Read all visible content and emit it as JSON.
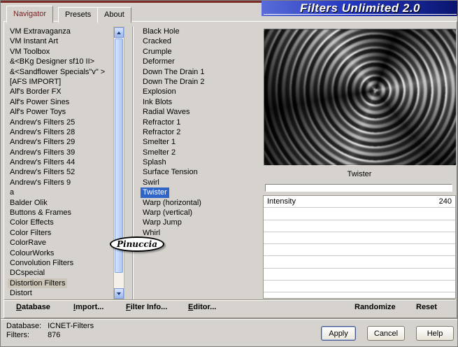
{
  "window": {
    "title": "Filters Unlimited 2.0"
  },
  "tabs": [
    {
      "label": "Navigator"
    },
    {
      "label": "Presets"
    },
    {
      "label": "About"
    }
  ],
  "category_list": {
    "items": [
      "VM Extravaganza",
      "VM Instant Art",
      "VM Toolbox",
      "&<BKg Designer sf10 II>",
      "&<Sandflower Specials\"v\" >",
      "[AFS IMPORT]",
      "Alf's Border FX",
      "Alf's Power Sines",
      "Alf's Power Toys",
      "Andrew's Filters 25",
      "Andrew's Filters 28",
      "Andrew's Filters 29",
      "Andrew's Filters 39",
      "Andrew's Filters 44",
      "Andrew's Filters 52",
      "Andrew's Filters 9",
      "a",
      "Balder Olik",
      "Buttons & Frames",
      "Color Effects",
      "Color Filters",
      "ColorRave",
      "ColourWorks",
      "Convolution Filters",
      "DCspecial",
      "Distortion Filters",
      "Distort"
    ],
    "selected": "Distortion Filters"
  },
  "filter_list": {
    "items": [
      "Black Hole",
      "Cracked",
      "Crumple",
      "Deformer",
      "Down The Drain 1",
      "Down The Drain 2",
      "Explosion",
      "Ink Blots",
      "Radial Waves",
      "Refractor 1",
      "Refractor 2",
      "Smelter 1",
      "Smelter 2",
      "Splash",
      "Surface Tension",
      "Swirl",
      "Twister",
      "Warp (horizontal)",
      "Warp (vertical)",
      "Warp Jump",
      "Whirl"
    ],
    "selected": "Twister"
  },
  "watermark": "Pinuccia",
  "preview": {
    "caption": "Twister"
  },
  "params": {
    "rows": [
      {
        "label": "Intensity",
        "value": "240"
      }
    ],
    "empty_rows": 8
  },
  "toolbar": {
    "database": "Database",
    "import": "Import...",
    "filter_info": "Filter Info...",
    "editor": "Editor...",
    "randomize": "Randomize",
    "reset": "Reset"
  },
  "status": {
    "database_label": "Database:",
    "database_value": "ICNET-Filters",
    "filters_label": "Filters:",
    "filters_value": "876"
  },
  "actions": {
    "apply": "Apply",
    "cancel": "Cancel",
    "help": "Help"
  },
  "colors": {
    "selection_blue": "#2f64c8",
    "banner_from": "#5a6cd8",
    "banner_to": "#0a156e",
    "category_highlight": "#cbc6b8"
  }
}
